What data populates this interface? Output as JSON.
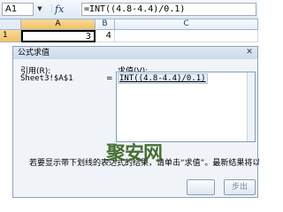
{
  "formula_bar": {
    "name_box": "A1",
    "name_arrow": "▼",
    "fx_label": "fx",
    "formula": "=INT((4.8-4.4)/0.1)"
  },
  "sheet": {
    "columns": [
      "A",
      "B",
      "C"
    ],
    "row_number": "1",
    "cells": [
      "3",
      "4",
      ""
    ]
  },
  "dialog": {
    "title": "公式求值",
    "close_label": "✕",
    "reference_label": "引用(R):",
    "reference_value": "Sheet3!$A$1",
    "equals": "=",
    "evaluation_label": "求值(V):",
    "evaluation_text": "INT((4.8-4.4)/0.1)",
    "help_text": "若要显示带下划线的表达式的结果，请单击“求值”。最新结果将以斜体",
    "buttons": [
      "",
      "步出"
    ]
  },
  "watermark": "聚安网"
}
